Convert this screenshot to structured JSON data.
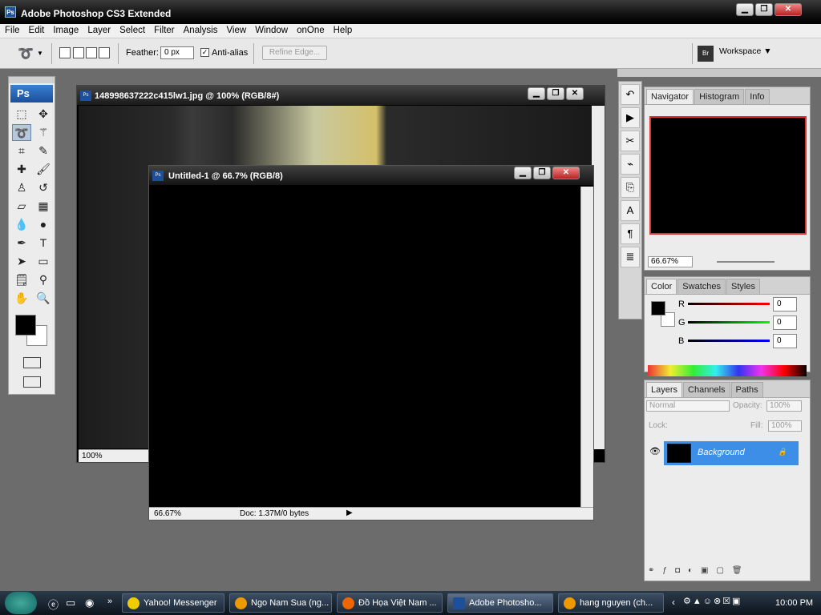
{
  "app": {
    "title": "Adobe Photoshop CS3 Extended",
    "icon": "ps-icon"
  },
  "menu": [
    "File",
    "Edit",
    "Image",
    "Layer",
    "Select",
    "Filter",
    "Analysis",
    "View",
    "Window",
    "onOne",
    "Help"
  ],
  "options": {
    "feather_label": "Feather:",
    "feather_value": "0 px",
    "antialias_label": "Anti-alias",
    "antialias_checked": true,
    "refine_label": "Refine Edge...",
    "workspace_label": "Workspace"
  },
  "toolbox": {
    "logo": "Ps",
    "tools": [
      "marquee-icon",
      "move-icon",
      "lasso-icon",
      "magic-wand-icon",
      "crop-icon",
      "eyedropper-icon",
      "healing-icon",
      "brush-icon",
      "stamp-icon",
      "history-brush-icon",
      "eraser-icon",
      "gradient-icon",
      "blur-icon",
      "dodge-icon",
      "pen-icon",
      "type-icon",
      "path-select-icon",
      "shape-icon",
      "notes-icon",
      "eyedropper2-icon",
      "hand-icon",
      "zoom-icon"
    ],
    "fg": "#000000",
    "bg": "#ffffff"
  },
  "doc1": {
    "title": "148998637222c415lw1.jpg @ 100% (RGB/8#)",
    "zoom": "100%"
  },
  "doc2": {
    "title": "Untitled-1 @ 66.7% (RGB/8)",
    "zoom": "66.67%",
    "docsize": "Doc: 1.37M/0 bytes"
  },
  "navigator": {
    "tabs": [
      "Navigator",
      "Histogram",
      "Info"
    ],
    "zoom": "66.67%"
  },
  "color": {
    "tabs": [
      "Color",
      "Swatches",
      "Styles"
    ],
    "r_label": "R",
    "g_label": "G",
    "b_label": "B",
    "r": "0",
    "g": "0",
    "b": "0"
  },
  "layers": {
    "tabs": [
      "Layers",
      "Channels",
      "Paths"
    ],
    "blend": "Normal",
    "opacity_label": "Opacity:",
    "opacity": "100%",
    "lock_label": "Lock:",
    "fill_label": "Fill:",
    "fill": "100%",
    "layer_name": "Background"
  },
  "taskbar": {
    "items": [
      "Yahoo! Messenger",
      "Ngo Nam Sua (ng...",
      "Đồ Họa Việt Nam ...",
      "Adobe Photosho...",
      "hang nguyen (ch..."
    ],
    "clock": "10:00 PM"
  }
}
